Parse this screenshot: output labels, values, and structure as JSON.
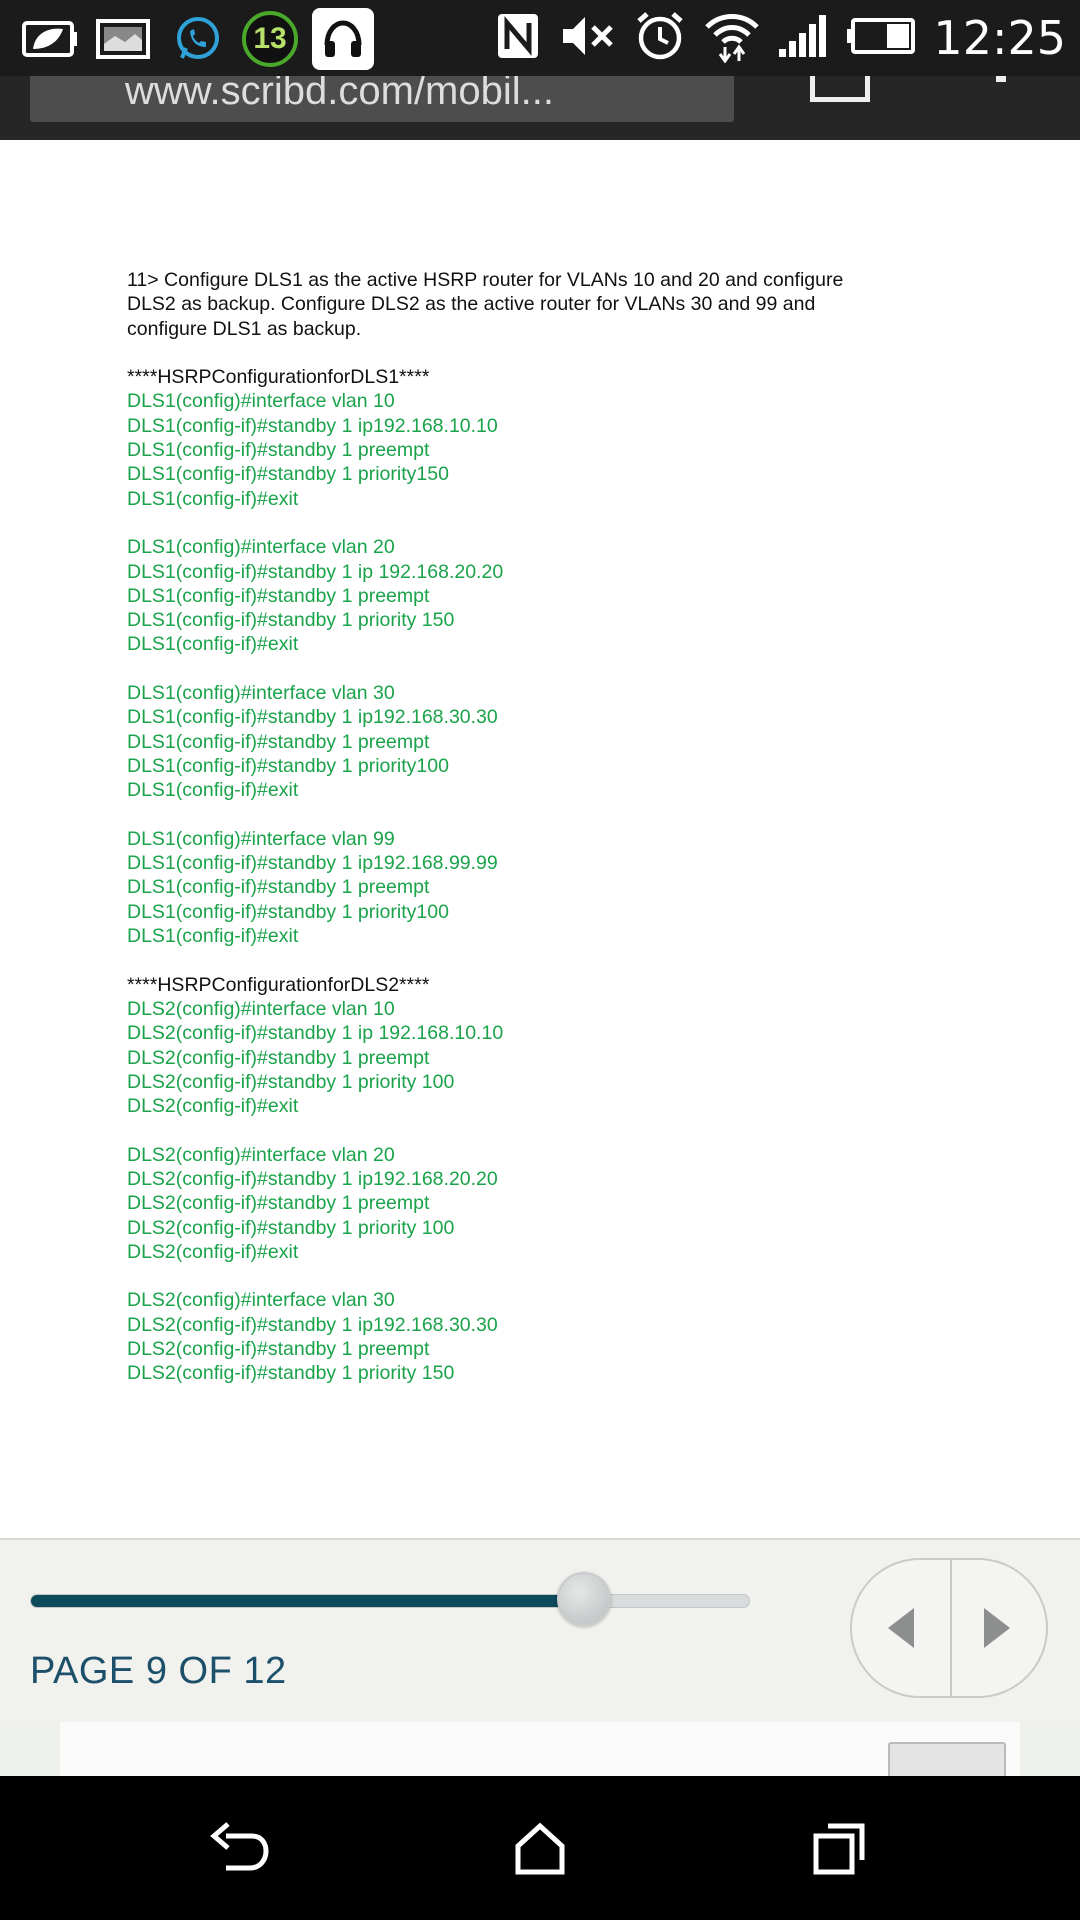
{
  "status_bar": {
    "time": "12:25",
    "notification_count": "13",
    "icons": [
      "charging-leaf-icon",
      "gallery-icon",
      "whatsapp-icon",
      "notification-count-badge",
      "headphones-icon",
      "nfc-icon",
      "mute-icon",
      "alarm-icon",
      "wifi-icon",
      "signal-icon",
      "battery-icon"
    ]
  },
  "browser": {
    "url": "www.scribd.com/mobil..."
  },
  "document": {
    "intro": [
      "11> Configure DLS1 as the active HSRP router for VLANs 10 and 20 and configure",
      "DLS2 as backup. Configure DLS2 as the active router for VLANs 30 and 99 and",
      "configure DLS1 as backup."
    ],
    "heading1": "****HSRPConfigurationforDLS1****",
    "dls1_blocks": [
      [
        "DLS1(config)#interface vlan 10",
        "DLS1(config-if)#standby 1 ip192.168.10.10",
        "DLS1(config-if)#standby 1 preempt",
        "DLS1(config-if)#standby 1 priority150",
        "DLS1(config-if)#exit"
      ],
      [
        "DLS1(config)#interface vlan 20",
        "DLS1(config-if)#standby 1 ip 192.168.20.20",
        "DLS1(config-if)#standby 1 preempt",
        "DLS1(config-if)#standby 1 priority 150",
        "DLS1(config-if)#exit"
      ],
      [
        "DLS1(config)#interface vlan 30",
        "DLS1(config-if)#standby 1 ip192.168.30.30",
        "DLS1(config-if)#standby 1 preempt",
        "DLS1(config-if)#standby 1 priority100",
        "DLS1(config-if)#exit"
      ],
      [
        "DLS1(config)#interface vlan 99",
        "DLS1(config-if)#standby 1 ip192.168.99.99",
        "DLS1(config-if)#standby 1 preempt",
        "DLS1(config-if)#standby 1 priority100",
        "DLS1(config-if)#exit"
      ]
    ],
    "heading2": "****HSRPConfigurationforDLS2****",
    "dls2_blocks": [
      [
        "DLS2(config)#interface vlan 10",
        "DLS2(config-if)#standby 1 ip 192.168.10.10",
        "DLS2(config-if)#standby 1 preempt",
        "DLS2(config-if)#standby 1 priority 100",
        "DLS2(config-if)#exit"
      ],
      [
        "DLS2(config)#interface vlan 20",
        "DLS2(config-if)#standby 1 ip192.168.20.20",
        "DLS2(config-if)#standby 1 preempt",
        "DLS2(config-if)#standby 1 priority 100",
        "DLS2(config-if)#exit"
      ],
      [
        "DLS2(config)#interface vlan 30",
        "DLS2(config-if)#standby 1 ip192.168.30.30",
        "DLS2(config-if)#standby 1 preempt",
        "DLS2(config-if)#standby 1 priority 150"
      ]
    ]
  },
  "reader": {
    "page_label": "PAGE 9 OF 12",
    "current_page": 9,
    "total_pages": 12,
    "progress_fraction": 0.77
  },
  "colors": {
    "config_text": "#1aa34a",
    "accent": "#0d4a5c",
    "page_label": "#1b4f6a"
  }
}
